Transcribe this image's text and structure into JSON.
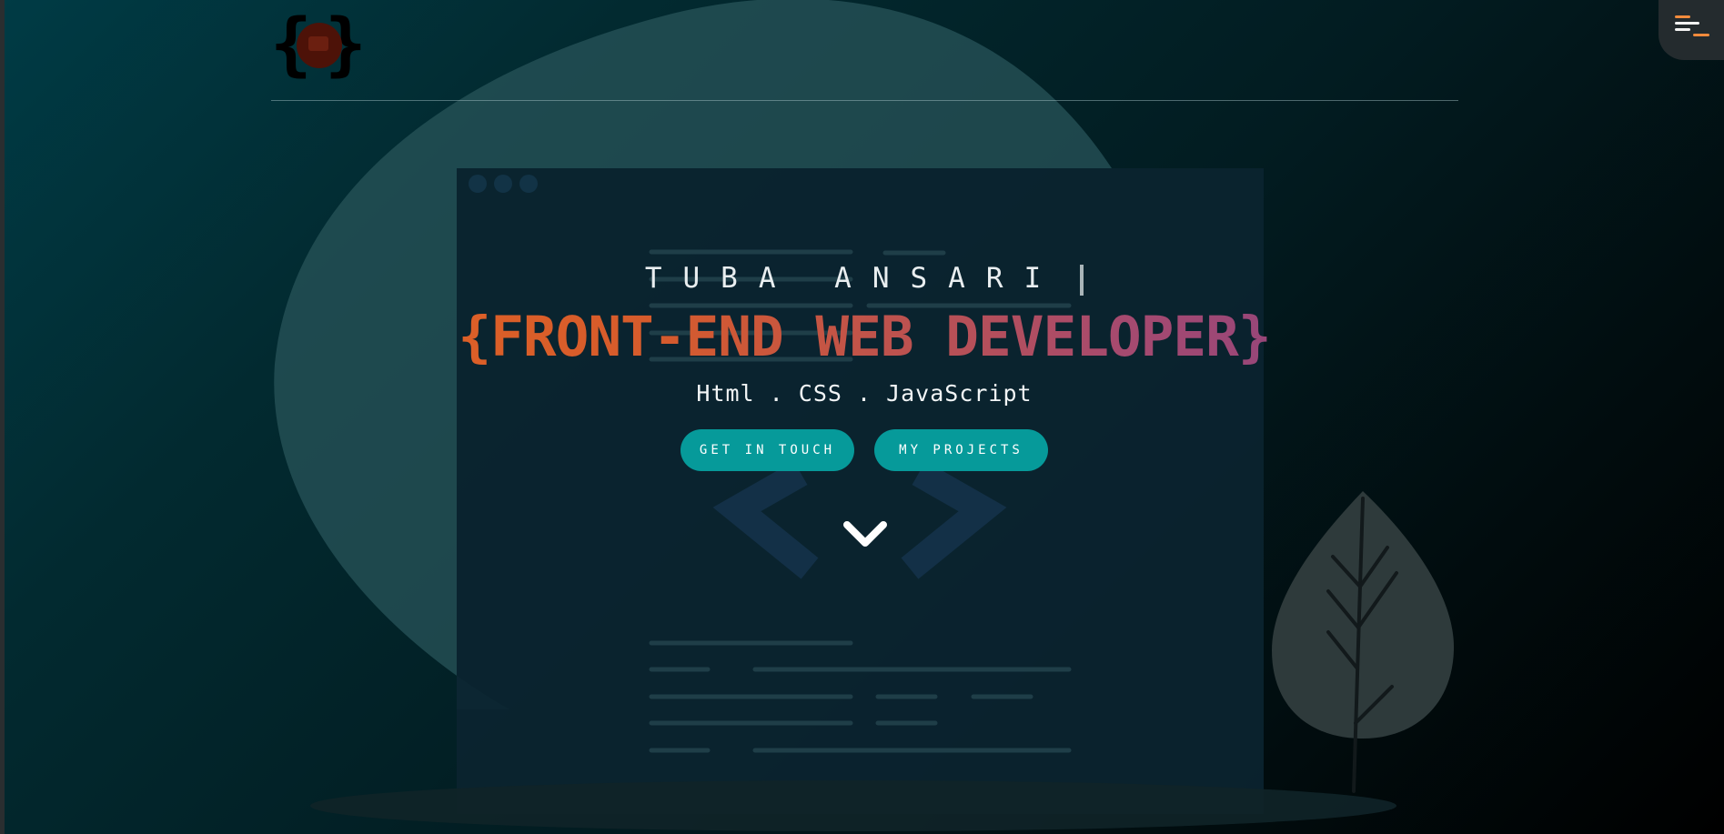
{
  "header": {
    "logo_icon": "curly-braces-logo-icon",
    "menu_icon": "hamburger-menu-icon"
  },
  "hero": {
    "name": "TUBA ANSARI",
    "role": "{FRONT-END WEB DEVELOPER}",
    "skills": "Html . CSS . JavaScript",
    "primary_button_label": "GET IN TOUCH",
    "secondary_button_label": "MY PROJECTS",
    "scroll_icon": "chevron-down-icon"
  },
  "colors": {
    "accent": "#069a9a",
    "role_gradient_start": "#ea6a1c",
    "role_gradient_end": "#6b3b97",
    "menu_bar_orange": "#f28b3c"
  }
}
